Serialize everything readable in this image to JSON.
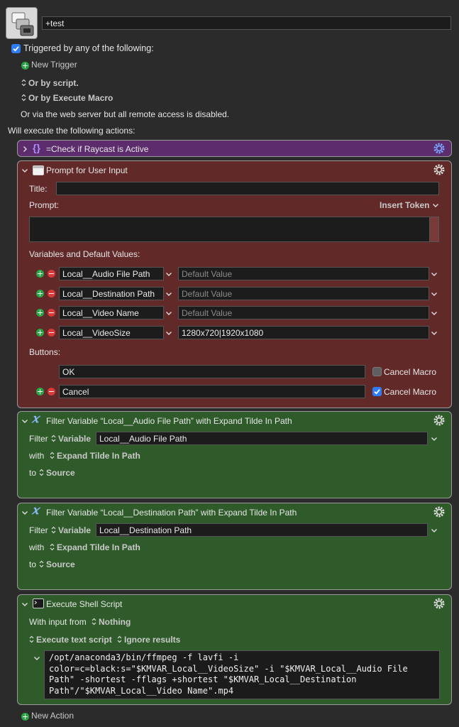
{
  "macro": {
    "name": "+test"
  },
  "triggers": {
    "triggered_label": "Triggered by any of the following:",
    "new_trigger": "New Trigger",
    "or_by_script": "Or by script.",
    "or_by_execute_macro": "Or by Execute Macro",
    "web_server_note": "Or via the web server but all remote access is disabled."
  },
  "actions_header": "Will execute the following actions:",
  "check_action": {
    "title": "=Check if Raycast is Active"
  },
  "prompt_action": {
    "title": "Prompt for User Input",
    "title_label": "Title:",
    "title_value": "",
    "prompt_label": "Prompt:",
    "insert_token": "Insert Token",
    "variables_label": "Variables and Default Values:",
    "default_placeholder": "Default Value",
    "variables": [
      {
        "name": "Local__Audio File Path",
        "value": ""
      },
      {
        "name": "Local__Destination Path",
        "value": ""
      },
      {
        "name": "Local__Video Name",
        "value": ""
      },
      {
        "name": "Local__VideoSize",
        "value": "1280x720|1920x1080"
      }
    ],
    "buttons_label": "Buttons:",
    "buttons": [
      {
        "name": "OK",
        "cancel_label": "Cancel Macro",
        "cancel_checked": false
      },
      {
        "name": "Cancel",
        "cancel_label": "Cancel Macro",
        "cancel_checked": true
      }
    ]
  },
  "filter_actions": [
    {
      "title": "Filter Variable “Local__Audio File Path” with Expand Tilde In Path",
      "filter_label": "Filter",
      "variable_mode": "Variable",
      "variable_value": "Local__Audio File Path",
      "with_label": "with",
      "with_value": "Expand Tilde In Path",
      "to_label": "to",
      "to_value": "Source"
    },
    {
      "title": "Filter Variable “Local__Destination Path” with Expand Tilde In Path",
      "filter_label": "Filter",
      "variable_mode": "Variable",
      "variable_value": "Local__Destination Path",
      "with_label": "with",
      "with_value": "Expand Tilde In Path",
      "to_label": "to",
      "to_value": "Source"
    }
  ],
  "shell_action": {
    "title": "Execute Shell Script",
    "input_label": "With input from",
    "input_value": "Nothing",
    "mode": "Execute text script",
    "results": "Ignore results",
    "script_lines": [
      "/opt/anaconda3/bin/ffmpeg -f lavfi -i",
      "color=c=black:s=\"$KMVAR_Local__VideoSize\" -i \"$KMVAR_Local__Audio File",
      "Path\" -shortest -fflags +shortest \"$KMVAR_Local__Destination",
      "Path\"/\"$KMVAR_Local__Video Name\".mp4"
    ]
  },
  "new_action": "New Action",
  "colors": {
    "background": "#2b2b2b",
    "purple_panel": "#5c2c6d",
    "red_panel": "#612a29",
    "green_panel": "#2f5b2a",
    "accent_blue": "#2f7cf6",
    "add_green": "#27a744",
    "remove_red": "#d63a3a"
  },
  "icons": [
    "macro-group-icon",
    "braces-icon",
    "gear-icon",
    "window-icon",
    "filter-x-icon",
    "terminal-icon",
    "plus-icon",
    "minus-icon",
    "chevron-down-icon",
    "chevron-right-icon",
    "updown-arrows-icon"
  ]
}
